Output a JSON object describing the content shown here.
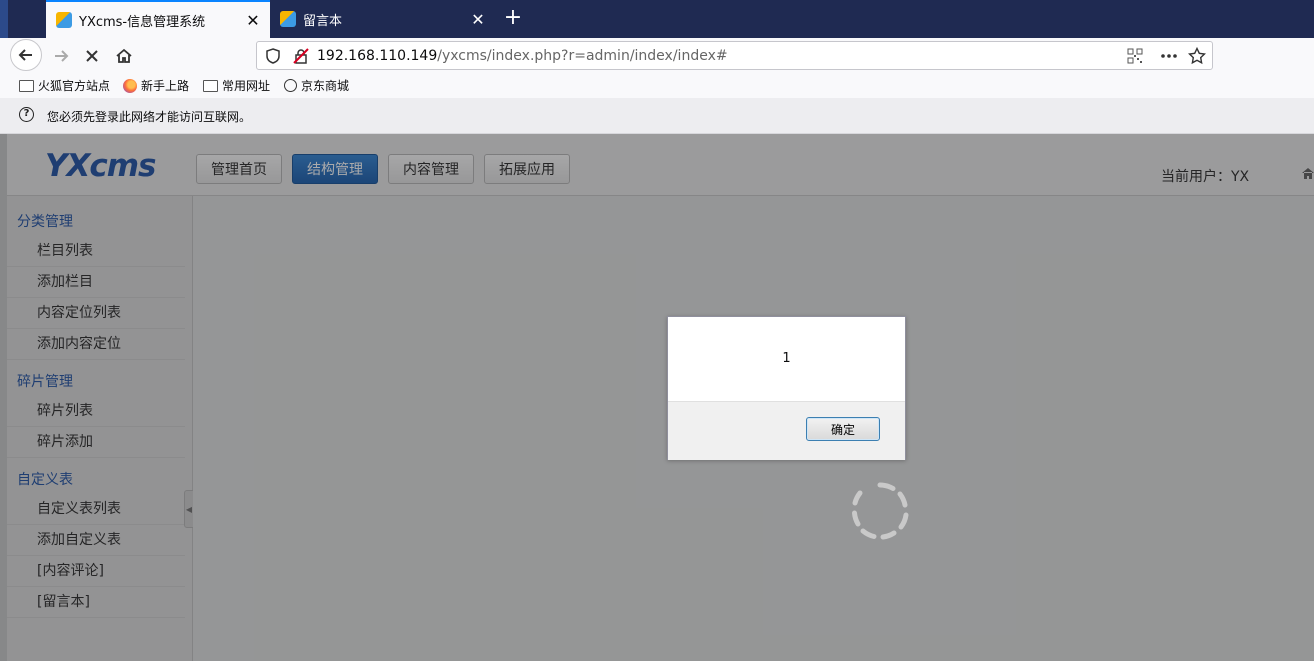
{
  "browser": {
    "tabs": [
      {
        "title": "YXcms-信息管理系统",
        "active": true
      },
      {
        "title": "留言本",
        "active": false
      }
    ],
    "new_tab_label": "+",
    "url": {
      "host": "192.168.110.149",
      "path": "/yxcms/index.php?r=admin/index/index#"
    },
    "bookmarks": [
      {
        "label": "火狐官方站点",
        "icon": "folder-icon"
      },
      {
        "label": "新手上路",
        "icon": "firefox-icon"
      },
      {
        "label": "常用网址",
        "icon": "folder-icon"
      },
      {
        "label": "京东商城",
        "icon": "globe-icon"
      }
    ],
    "notice": "您必须先登录此网络才能访问互联网。"
  },
  "app": {
    "logo": "YXcms",
    "topnav": [
      {
        "label": "管理首页",
        "active": false
      },
      {
        "label": "结构管理",
        "active": true
      },
      {
        "label": "内容管理",
        "active": false
      },
      {
        "label": "拓展应用",
        "active": false
      }
    ],
    "current_user": "当前用户：YX",
    "sidebar": {
      "groups": [
        {
          "title": "分类管理",
          "items": [
            "栏目列表",
            "添加栏目",
            "内容定位列表",
            "添加内容定位"
          ]
        },
        {
          "title": "碎片管理",
          "items": [
            "碎片列表",
            "碎片添加"
          ]
        },
        {
          "title": "自定义表",
          "items": [
            "自定义表列表",
            "添加自定义表",
            "[内容评论]",
            "[留言本]"
          ]
        }
      ]
    }
  },
  "dialog": {
    "message": "1",
    "ok_label": "确定"
  },
  "colors": {
    "accent": "#2a5aa8",
    "tab_accent": "#0a84ff",
    "tabbar_bg": "#1f2a52"
  }
}
